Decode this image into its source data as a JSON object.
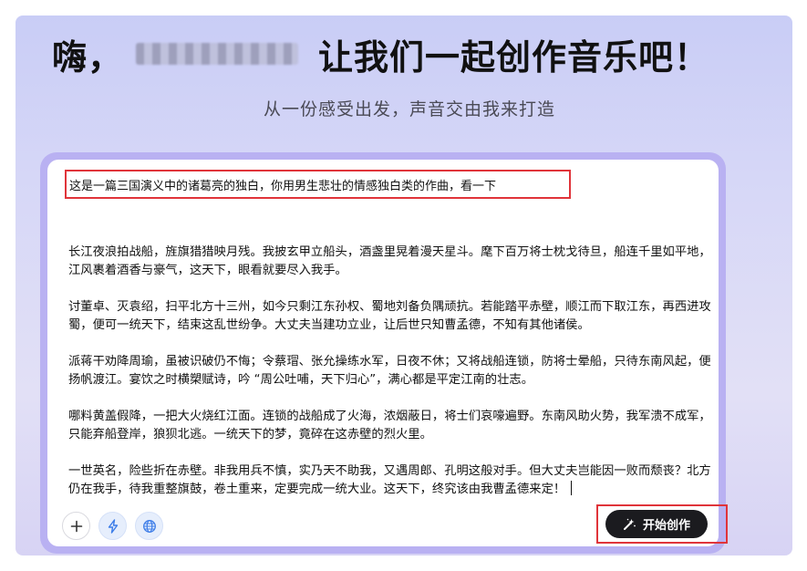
{
  "header": {
    "greeting": "嗨，",
    "tagline": "让我们一起创作音乐吧！",
    "subtitle": "从一份感受出发，声音交由我来打造"
  },
  "editor": {
    "prompt": "这是一篇三国演义中的诸葛亮的独白，你用男生悲壮的情感独白类的作曲，看一下",
    "paragraphs": [
      "长江夜浪拍战船，旌旗猎猎映月残。我披玄甲立船头，酒盏里晃着漫天星斗。麾下百万将士枕戈待旦，船连千里如平地，江风裹着酒香与豪气，这天下，眼看就要尽入我手。",
      "讨董卓、灭袁绍，扫平北方十三州，如今只剩江东孙权、蜀地刘备负隅顽抗。若能踏平赤壁，顺江而下取江东，再西进攻蜀，便可一统天下，结束这乱世纷争。大丈夫当建功立业，让后世只知曹孟德，不知有其他诸侯。",
      "派蒋干劝降周瑜，虽被识破仍不悔；令蔡瑁、张允操练水军，日夜不休；又将战船连锁，防将士晕船，只待东南风起，便扬帆渡江。宴饮之时横槊赋诗，吟 “周公吐哺，天下归心”，满心都是平定江南的壮志。",
      "哪料黄盖假降，一把大火烧红江面。连锁的战船成了火海，浓烟蔽日，将士们哀嚎遍野。东南风助火势，我军溃不成军，只能弃船登岸，狼狈北逃。一统天下的梦，竟碎在这赤壁的烈火里。",
      "一世英名，险些折在赤壁。非我用兵不慎，实乃天不助我，又遇周郎、孔明这般对手。但大丈夫岂能因一败而颓丧？北方仍在我手，待我重整旗鼓，卷土重来，定要完成一统大业。这天下，终究该由我曹孟德来定！"
    ]
  },
  "toolbar": {
    "add_icon": "plus-icon",
    "lightning_icon": "lightning-icon",
    "globe_icon": "globe-icon",
    "create_label": "开始创作",
    "create_icon": "magic-wand-icon"
  },
  "colors": {
    "background_gradient_top": "#c9cdf6",
    "panel_border": "#b9b1f2",
    "highlight_box": "#e0343a",
    "create_button": "#1b1b1f",
    "accent_icon": "#3d7de8"
  }
}
